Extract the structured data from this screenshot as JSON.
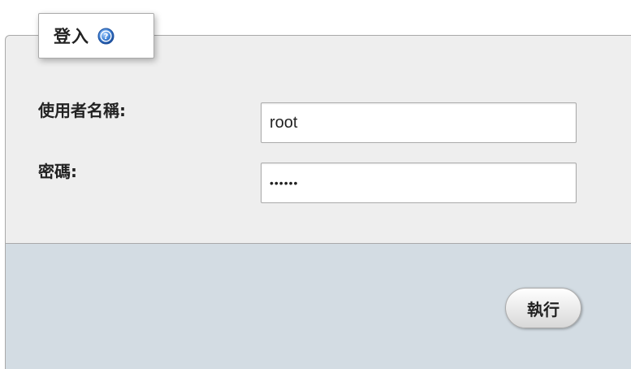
{
  "login": {
    "legend": "登入",
    "help_icon": "help-icon",
    "username_label": "使用者名稱:",
    "username_value": "root",
    "password_label": "密碼:",
    "password_value": "••••••",
    "submit_label": "執行"
  },
  "colors": {
    "fieldset_bg": "#eeeeee",
    "footer_bg": "#d3dce3",
    "help_icon_blue": "#3b7fd4"
  }
}
